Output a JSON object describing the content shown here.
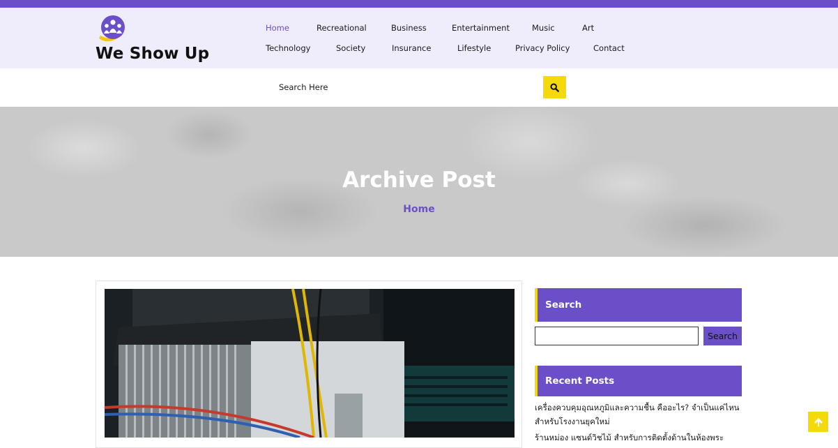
{
  "site": {
    "title": "We Show Up"
  },
  "nav": {
    "row1": [
      "Home",
      "Recreational",
      "Business",
      "Entertainment",
      "Music",
      "Art"
    ],
    "row2": [
      "Technology",
      "Society",
      "Insurance",
      "Lifestyle",
      "Privacy Policy",
      "Contact"
    ]
  },
  "search": {
    "placeholder": "Search Here",
    "icon": "search-icon"
  },
  "hero": {
    "title": "Archive Post",
    "breadcrumb": "Home"
  },
  "sidebar": {
    "search_title": "Search",
    "search_button": "Search",
    "recent_title": "Recent Posts",
    "recent_posts": [
      "เครื่องควบคุมอุณหภูมิและความชื้น คืออะไร? จำเป็นแค่ไหนสำหรับโรงงานยุคใหม่",
      "ร้านหม่อง แซนด์วิชไม้ สำหรับการติดตั้งด้านในห้องพระ"
    ]
  },
  "colors": {
    "accent": "#6b4fc8",
    "highlight": "#f5d90a",
    "header_bg": "#efedfb"
  },
  "icons": {
    "back_to_top": "arrow-up-icon",
    "logo": "people-logo-icon"
  }
}
